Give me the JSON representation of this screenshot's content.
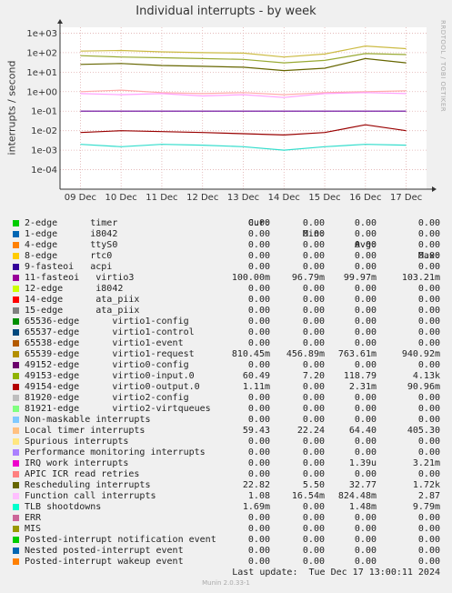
{
  "chart_data": {
    "type": "line",
    "title": "Individual interrupts - by week",
    "ylabel": "interrupts / second",
    "yscale": "log",
    "ylim": [
      1e-05,
      2000
    ],
    "yticks": [
      "1e+03",
      "1e+02",
      "1e+01",
      "1e+00",
      "1e-01",
      "1e-02",
      "1e-03",
      "1e-04"
    ],
    "x": [
      "09 Dec",
      "10 Dec",
      "11 Dec",
      "12 Dec",
      "13 Dec",
      "14 Dec",
      "15 Dec",
      "16 Dec",
      "17 Dec"
    ],
    "grid": true,
    "plotted": [
      {
        "name": "Local timer interrupts",
        "color": "#ccbb44",
        "values": [
          120,
          130,
          110,
          100,
          95,
          60,
          85,
          220,
          160
        ]
      },
      {
        "name": "virtio0-input.0",
        "color": "#99aa33",
        "values": [
          70,
          60,
          55,
          50,
          45,
          30,
          40,
          90,
          80
        ]
      },
      {
        "name": "Rescheduling interrupts",
        "color": "#666600",
        "values": [
          25,
          28,
          22,
          20,
          18,
          12,
          16,
          50,
          30
        ]
      },
      {
        "name": "Function call interrupts",
        "color": "#ffaaaa",
        "values": [
          1.0,
          1.2,
          0.9,
          0.8,
          0.9,
          0.7,
          0.9,
          1.0,
          1.1
        ]
      },
      {
        "name": "virtio1-request",
        "color": "#ffa0ff",
        "values": [
          0.8,
          0.7,
          0.8,
          0.6,
          0.7,
          0.5,
          0.8,
          0.9,
          0.8
        ]
      },
      {
        "name": "virtio3",
        "color": "#660099",
        "values": [
          0.1,
          0.1,
          0.1,
          0.1,
          0.1,
          0.1,
          0.1,
          0.1,
          0.1
        ]
      },
      {
        "name": "virtio0-output.0",
        "color": "#990000",
        "values": [
          0.008,
          0.01,
          0.009,
          0.008,
          0.007,
          0.006,
          0.008,
          0.02,
          0.01
        ]
      },
      {
        "name": "TLB shootdowns",
        "color": "#33ddcc",
        "values": [
          0.002,
          0.0015,
          0.002,
          0.0018,
          0.0015,
          0.001,
          0.0015,
          0.002,
          0.0018
        ]
      }
    ]
  },
  "header": {
    "cur": "Cur:",
    "min": "Min:",
    "avg": "Avg:",
    "max": "Max:"
  },
  "legend": [
    {
      "label": "2-edge      timer",
      "color": "#00cc00",
      "cur": "0.00",
      "min": "0.00",
      "avg": "0.00",
      "max": "0.00"
    },
    {
      "label": "1-edge      i8042",
      "color": "#0066b3",
      "cur": "0.00",
      "min": "0.00",
      "avg": "0.00",
      "max": "0.00"
    },
    {
      "label": "4-edge      ttyS0",
      "color": "#ff8000",
      "cur": "0.00",
      "min": "0.00",
      "avg": "0.00",
      "max": "0.00"
    },
    {
      "label": "8-edge      rtc0",
      "color": "#ffcc00",
      "cur": "0.00",
      "min": "0.00",
      "avg": "0.00",
      "max": "0.00"
    },
    {
      "label": "9-fasteoi   acpi",
      "color": "#330099",
      "cur": "0.00",
      "min": "0.00",
      "avg": "0.00",
      "max": "0.00"
    },
    {
      "label": "11-fasteoi   virtio3",
      "color": "#990099",
      "cur": "100.00m",
      "min": "96.79m",
      "avg": "99.97m",
      "max": "103.21m"
    },
    {
      "label": "12-edge      i8042",
      "color": "#ccff00",
      "cur": "0.00",
      "min": "0.00",
      "avg": "0.00",
      "max": "0.00"
    },
    {
      "label": "14-edge      ata_piix",
      "color": "#ff0000",
      "cur": "0.00",
      "min": "0.00",
      "avg": "0.00",
      "max": "0.00"
    },
    {
      "label": "15-edge      ata_piix",
      "color": "#808080",
      "cur": "0.00",
      "min": "0.00",
      "avg": "0.00",
      "max": "0.00"
    },
    {
      "label": "65536-edge      virtio1-config",
      "color": "#008f00",
      "cur": "0.00",
      "min": "0.00",
      "avg": "0.00",
      "max": "0.00"
    },
    {
      "label": "65537-edge      virtio1-control",
      "color": "#00487d",
      "cur": "0.00",
      "min": "0.00",
      "avg": "0.00",
      "max": "0.00"
    },
    {
      "label": "65538-edge      virtio1-event",
      "color": "#b35a00",
      "cur": "0.00",
      "min": "0.00",
      "avg": "0.00",
      "max": "0.00"
    },
    {
      "label": "65539-edge      virtio1-request",
      "color": "#b38f00",
      "cur": "810.45m",
      "min": "456.89m",
      "avg": "763.61m",
      "max": "940.92m"
    },
    {
      "label": "49152-edge      virtio0-config",
      "color": "#6b006b",
      "cur": "0.00",
      "min": "0.00",
      "avg": "0.00",
      "max": "0.00"
    },
    {
      "label": "49153-edge      virtio0-input.0",
      "color": "#8fb300",
      "cur": "60.49",
      "min": "7.20",
      "avg": "118.79",
      "max": "4.13k"
    },
    {
      "label": "49154-edge      virtio0-output.0",
      "color": "#b30000",
      "cur": "1.11m",
      "min": "0.00",
      "avg": "2.31m",
      "max": "90.96m"
    },
    {
      "label": "81920-edge      virtio2-config",
      "color": "#bebebe",
      "cur": "0.00",
      "min": "0.00",
      "avg": "0.00",
      "max": "0.00"
    },
    {
      "label": "81921-edge      virtio2-virtqueues",
      "color": "#80ff80",
      "cur": "0.00",
      "min": "0.00",
      "avg": "0.00",
      "max": "0.00"
    },
    {
      "label": "Non-maskable interrupts",
      "color": "#80c9ff",
      "cur": "0.00",
      "min": "0.00",
      "avg": "0.00",
      "max": "0.00"
    },
    {
      "label": "Local timer interrupts",
      "color": "#ffc080",
      "cur": "59.43",
      "min": "22.24",
      "avg": "64.40",
      "max": "405.30"
    },
    {
      "label": "Spurious interrupts",
      "color": "#ffe680",
      "cur": "0.00",
      "min": "0.00",
      "avg": "0.00",
      "max": "0.00"
    },
    {
      "label": "Performance monitoring interrupts",
      "color": "#aa80ff",
      "cur": "0.00",
      "min": "0.00",
      "avg": "0.00",
      "max": "0.00"
    },
    {
      "label": "IRQ work interrupts",
      "color": "#ee00cc",
      "cur": "0.00",
      "min": "0.00",
      "avg": "1.39u",
      "max": "3.21m"
    },
    {
      "label": "APIC ICR read retries",
      "color": "#ff8080",
      "cur": "0.00",
      "min": "0.00",
      "avg": "0.00",
      "max": "0.00"
    },
    {
      "label": "Rescheduling interrupts",
      "color": "#666600",
      "cur": "22.82",
      "min": "5.50",
      "avg": "32.77",
      "max": "1.72k"
    },
    {
      "label": "Function call interrupts",
      "color": "#ffbfff",
      "cur": "1.08",
      "min": "16.54m",
      "avg": "824.48m",
      "max": "2.87"
    },
    {
      "label": "TLB shootdowns",
      "color": "#00ffcc",
      "cur": "1.69m",
      "min": "0.00",
      "avg": "1.48m",
      "max": "9.79m"
    },
    {
      "label": "ERR",
      "color": "#cc6699",
      "cur": "0.00",
      "min": "0.00",
      "avg": "0.00",
      "max": "0.00"
    },
    {
      "label": "MIS",
      "color": "#999900",
      "cur": "0.00",
      "min": "0.00",
      "avg": "0.00",
      "max": "0.00"
    },
    {
      "label": "Posted-interrupt notification event",
      "color": "#00cc00",
      "cur": "0.00",
      "min": "0.00",
      "avg": "0.00",
      "max": "0.00"
    },
    {
      "label": "Nested posted-interrupt event",
      "color": "#0066b3",
      "cur": "0.00",
      "min": "0.00",
      "avg": "0.00",
      "max": "0.00"
    },
    {
      "label": "Posted-interrupt wakeup event",
      "color": "#ff8000",
      "cur": "0.00",
      "min": "0.00",
      "avg": "0.00",
      "max": "0.00"
    }
  ],
  "footer": {
    "last_update": "Last update:  Tue Dec 17 13:00:11 2024",
    "version": "Munin 2.0.33-1",
    "watermark": "RRDTOOL / TOBI OETIKER"
  }
}
